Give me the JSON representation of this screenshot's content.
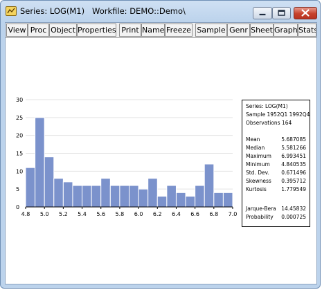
{
  "window": {
    "title": "Series: LOG(M1)   Workfile: DEMO::Demo\\",
    "controls": [
      "minimize",
      "maximize",
      "close"
    ]
  },
  "toolbar": {
    "buttons": [
      {
        "label": "View"
      },
      {
        "label": "Proc"
      },
      {
        "label": "Object"
      },
      {
        "label": "Properties"
      },
      {
        "label": "Print"
      },
      {
        "label": "Name"
      },
      {
        "label": "Freeze"
      },
      {
        "label": "Sample"
      },
      {
        "label": "Genr"
      },
      {
        "label": "Sheet"
      },
      {
        "label": "Graph"
      },
      {
        "label": "Stats"
      }
    ]
  },
  "chart_data": {
    "type": "bar",
    "x_ticks": [
      "4.8",
      "5.0",
      "5.2",
      "5.4",
      "5.6",
      "5.8",
      "6.0",
      "6.2",
      "6.4",
      "6.6",
      "6.8",
      "7.0"
    ],
    "y_ticks": [
      "0",
      "5",
      "10",
      "15",
      "20",
      "25",
      "30"
    ],
    "bin_width": 0.1,
    "bins_start": 4.8,
    "values": [
      11,
      25,
      14,
      8,
      7,
      6,
      6,
      6,
      8,
      6,
      6,
      6,
      5,
      8,
      3,
      6,
      4,
      3,
      6,
      12,
      4,
      4
    ],
    "xlim": [
      4.8,
      7.0
    ],
    "ylim": [
      0,
      30
    ],
    "grid": true,
    "bar_color": "#7b92cc"
  },
  "stats": {
    "series": "Series: LOG(M1)",
    "sample": "Sample 1952Q1 1992Q4",
    "observations": "Observations 164",
    "rows": [
      {
        "label": "Mean",
        "value": "5.687085"
      },
      {
        "label": "Median",
        "value": "5.581266"
      },
      {
        "label": "Maximum",
        "value": "6.993451"
      },
      {
        "label": "Minimum",
        "value": "4.840535"
      },
      {
        "label": "Std. Dev.",
        "value": "0.671496"
      },
      {
        "label": "Skewness",
        "value": "0.395712"
      },
      {
        "label": "Kurtosis",
        "value": "1.779549"
      }
    ],
    "tests": [
      {
        "label": "Jarque-Bera",
        "value": "14.45832"
      },
      {
        "label": "Probability",
        "value": "0.000725"
      }
    ]
  }
}
